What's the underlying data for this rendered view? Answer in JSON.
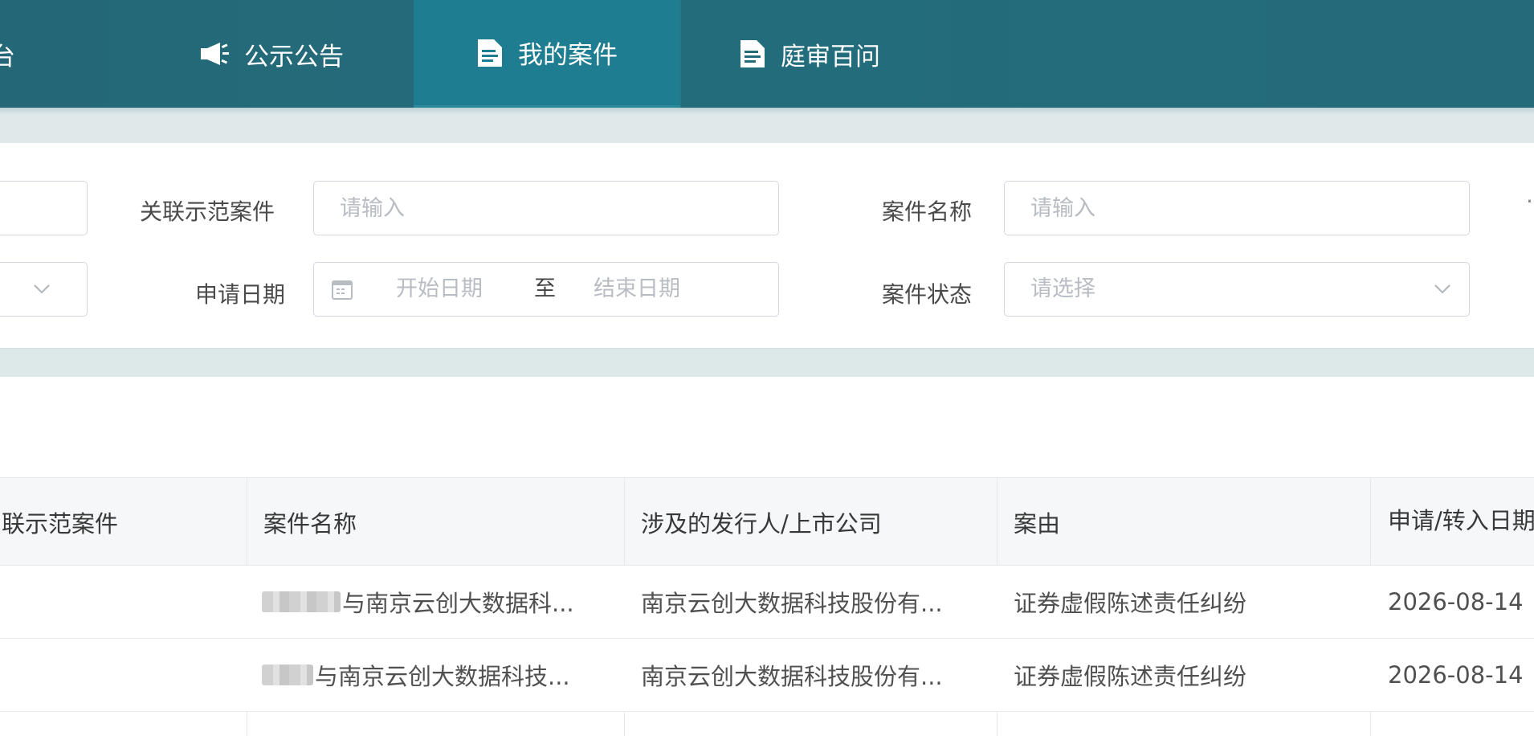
{
  "nav": {
    "partial_label": "台",
    "items": [
      {
        "label": "公示公告",
        "icon": "megaphone-icon"
      },
      {
        "label": "我的案件",
        "icon": "document-icon",
        "active": true
      },
      {
        "label": "庭审百问",
        "icon": "document-icon"
      }
    ]
  },
  "filters": {
    "related_case": {
      "label": "关联示范案件",
      "placeholder": "请输入"
    },
    "case_name": {
      "label": "案件名称",
      "placeholder": "请输入"
    },
    "apply_date": {
      "label": "申请日期",
      "start_placeholder": "开始日期",
      "separator": "至",
      "end_placeholder": "结束日期"
    },
    "case_status": {
      "label": "案件状态",
      "placeholder": "请选择"
    }
  },
  "table": {
    "columns": [
      "联示范案件",
      "案件名称",
      "涉及的发行人/上市公司",
      "案由",
      "申请/转入日期"
    ],
    "rows": [
      {
        "related": "",
        "case_name": "与南京云创大数据科...",
        "company": "南京云创大数据科技股份有...",
        "cause": "证券虚假陈述责任纠纷",
        "date": "2026-08-14"
      },
      {
        "related": "",
        "case_name": "与南京云创大数据科技...",
        "company": "南京云创大数据科技股份有...",
        "cause": "证券虚假陈述责任纠纷",
        "date": "2026-08-14"
      }
    ]
  },
  "colors": {
    "nav_bg": "#236c7c",
    "nav_active": "#1e7d90",
    "band": "#dfe9ea",
    "header_bg": "#f5f7f9"
  }
}
